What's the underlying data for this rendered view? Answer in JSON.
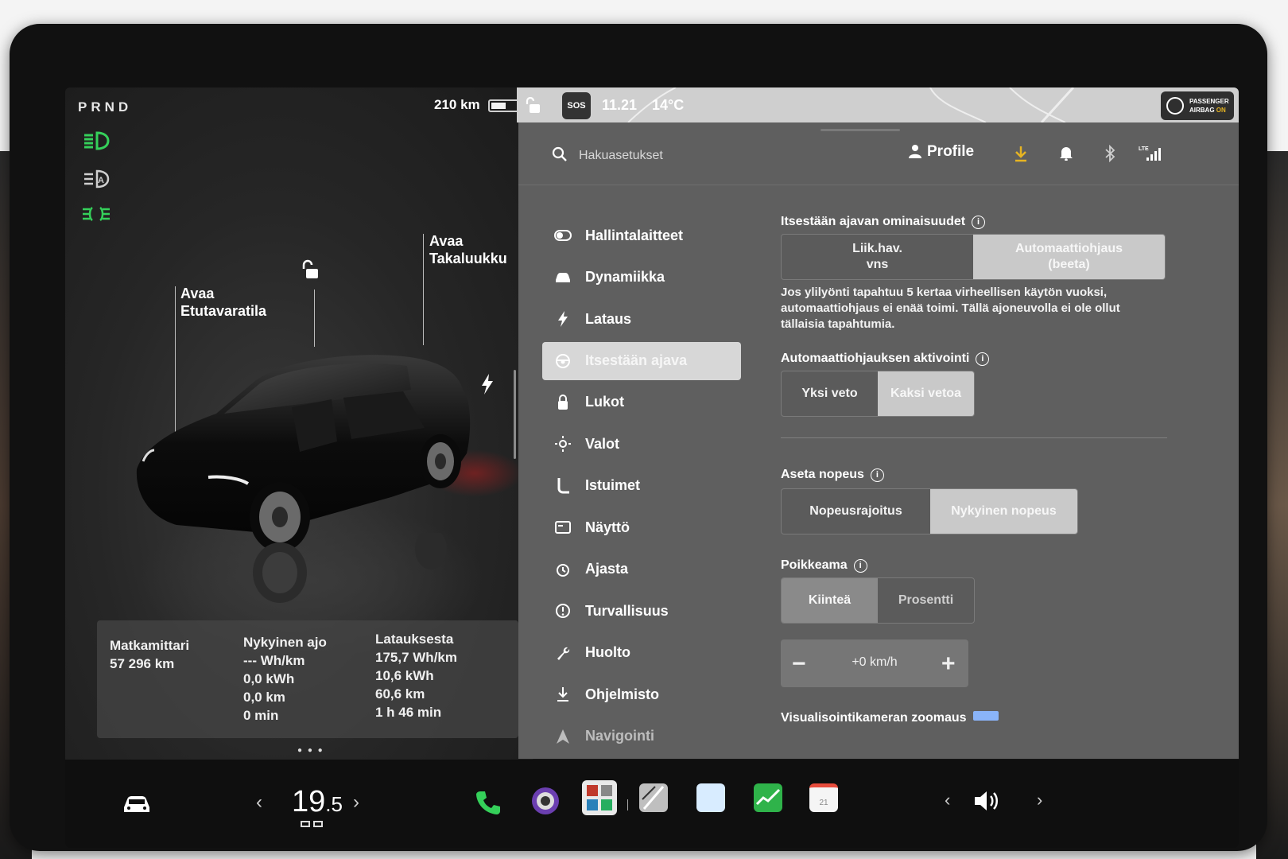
{
  "status": {
    "gear": "PRND",
    "range": "210 km",
    "battery_fraction": 0.55,
    "sos": "SOS",
    "time": "11.21",
    "temperature": "14°C",
    "airbag_line1": "PASSENGER",
    "airbag_line2": "AIRBAG",
    "airbag_state": "ON"
  },
  "car": {
    "frunk_label": "Avaa\nEtutavaratila",
    "trunk_label": "Avaa\nTakaluukku"
  },
  "trip": {
    "odometer": {
      "title": "Matkamittari",
      "lines": [
        "57 296 km"
      ]
    },
    "current": {
      "title": "Nykyinen ajo",
      "lines": [
        "--- Wh/km",
        "0,0 kWh",
        "0,0 km",
        "0 min"
      ]
    },
    "since_charge": {
      "title": "Latauksesta",
      "lines": [
        "175,7 Wh/km",
        "10,6 kWh",
        "60,6 km",
        "1 h 46 min"
      ]
    }
  },
  "settings": {
    "search_placeholder": "Hakuasetukset",
    "profile_label": "Profile",
    "menu": [
      {
        "label": "Hallintalaitteet",
        "icon": "toggle-icon"
      },
      {
        "label": "Dynamiikka",
        "icon": "car-icon"
      },
      {
        "label": "Lataus",
        "icon": "bolt-icon"
      },
      {
        "label": "Itsestään ajava",
        "icon": "steering-wheel-icon",
        "active": true
      },
      {
        "label": "Lukot",
        "icon": "lock-icon"
      },
      {
        "label": "Valot",
        "icon": "sun-icon"
      },
      {
        "label": "Istuimet",
        "icon": "seat-icon"
      },
      {
        "label": "Näyttö",
        "icon": "display-icon"
      },
      {
        "label": "Ajasta",
        "icon": "alarm-clock-icon"
      },
      {
        "label": "Turvallisuus",
        "icon": "alert-circle-icon"
      },
      {
        "label": "Huolto",
        "icon": "wrench-icon"
      },
      {
        "label": "Ohjelmisto",
        "icon": "download-icon"
      },
      {
        "label": "Navigointi",
        "icon": "navigation-icon"
      }
    ],
    "autopilot": {
      "features_title": "Itsestään ajavan ominaisuudet",
      "features_options": [
        "Liik.hav.\nvns",
        "Automaattiohjaus\n(beeta)"
      ],
      "features_selected": 1,
      "warning": "Jos ylilyönti tapahtuu 5 kertaa virheellisen käytön vuoksi, automaattiohjaus ei enää toimi. Tällä ajoneuvolla ei ole ollut tällaisia tapahtumia.",
      "activation_title": "Automaattiohjauksen aktivointi",
      "activation_options": [
        "Yksi veto",
        "Kaksi vetoa"
      ],
      "activation_selected": 1,
      "speed_title": "Aseta nopeus",
      "speed_options": [
        "Nopeusrajoitus",
        "Nykyinen nopeus"
      ],
      "speed_selected": 1,
      "offset_title": "Poikkeama",
      "offset_options": [
        "Kiinteä",
        "Prosentti"
      ],
      "offset_selected": 0,
      "offset_value": "+0 km/h",
      "zoom_title": "Visualisointikameran zoomaus"
    }
  },
  "bottom": {
    "temp_whole": "19",
    "temp_decimal": ".5",
    "calendar_day": "21"
  },
  "colors": {
    "headlight_green": "#35d05a",
    "download_yellow": "#e6b422"
  }
}
